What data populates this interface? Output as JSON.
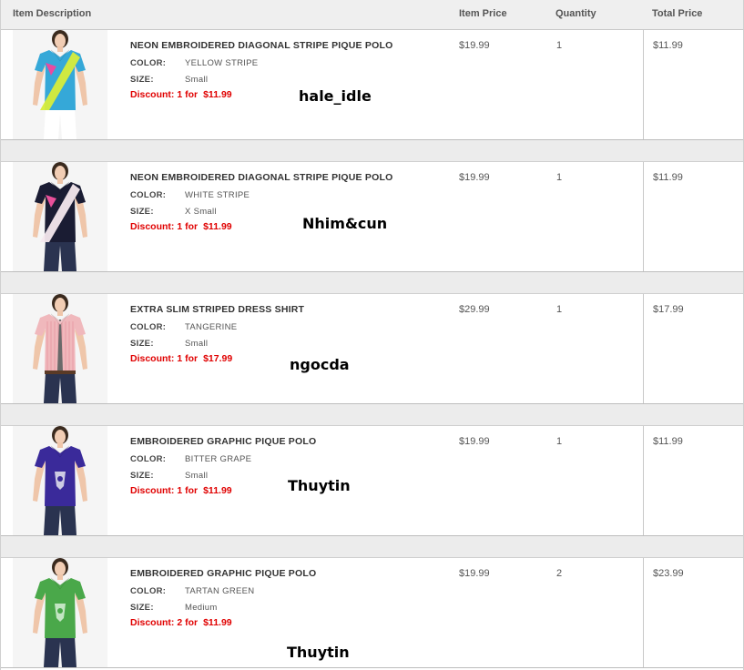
{
  "columns": {
    "description": "Item Description",
    "price": "Item Price",
    "quantity": "Quantity",
    "total": "Total Price"
  },
  "labels": {
    "color": "COLOR:",
    "size": "SIZE:"
  },
  "items": [
    {
      "name": "NEON EMBROIDERED DIAGONAL STRIPE PIQUE POLO",
      "color": "YELLOW STRIPE",
      "size": "Small",
      "discount_text": "Discount: 1 for",
      "discount_price": "$11.99",
      "price": "$19.99",
      "quantity": "1",
      "total": "$11.99",
      "tag": "hale_idle",
      "shirt_colors": [
        "#35a8d8",
        "#d8ec3a"
      ]
    },
    {
      "name": "NEON EMBROIDERED DIAGONAL STRIPE PIQUE POLO",
      "color": "WHITE STRIPE",
      "size": "X Small",
      "discount_text": "Discount: 1 for",
      "discount_price": "$11.99",
      "price": "$19.99",
      "quantity": "1",
      "total": "$11.99",
      "tag": "Nhim&cun",
      "shirt_colors": [
        "#1a1c33",
        "#f4e8ee"
      ]
    },
    {
      "name": "EXTRA SLIM STRIPED DRESS SHIRT",
      "color": "TANGERINE",
      "size": "Small",
      "discount_text": "Discount: 1 for",
      "discount_price": "$17.99",
      "price": "$29.99",
      "quantity": "1",
      "total": "$17.99",
      "tag": "ngocda",
      "shirt_colors": [
        "#f0b8bc",
        "#6a6a6a"
      ]
    },
    {
      "name": "EMBROIDERED GRAPHIC PIQUE POLO",
      "color": "BITTER GRAPE",
      "size": "Small",
      "discount_text": "Discount: 1 for",
      "discount_price": "$11.99",
      "price": "$19.99",
      "quantity": "1",
      "total": "$11.99",
      "tag": "Thuytin",
      "shirt_colors": [
        "#3a2a9a",
        "#e8e8f0"
      ]
    },
    {
      "name": "EMBROIDERED GRAPHIC PIQUE POLO",
      "color": "TARTAN GREEN",
      "size": "Medium",
      "discount_text": "Discount: 2 for",
      "discount_price": "$11.99",
      "price": "$19.99",
      "quantity": "2",
      "total": "$23.99",
      "tag": "Thuytin",
      "shirt_colors": [
        "#4aa84a",
        "#d8f0d8"
      ]
    }
  ]
}
